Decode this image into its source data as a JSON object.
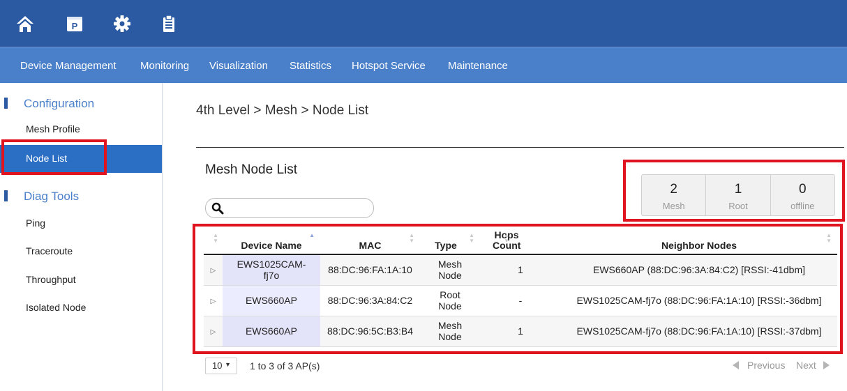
{
  "topbar": {
    "icons": [
      "home-icon",
      "parking-icon",
      "gear-icon",
      "clipboard-icon"
    ]
  },
  "nav": {
    "items": [
      "Device Management",
      "Monitoring",
      "Visualization",
      "Statistics",
      "Hotspot Service",
      "Maintenance"
    ]
  },
  "sidebar": {
    "section1": "Configuration",
    "items1": [
      "Mesh Profile",
      "Node List"
    ],
    "section2": "Diag Tools",
    "items2": [
      "Ping",
      "Traceroute",
      "Throughput",
      "Isolated Node"
    ]
  },
  "breadcrumb": "4th Level > Mesh > Node List",
  "list_title": "Mesh Node List",
  "search": {
    "placeholder": ""
  },
  "stats": [
    {
      "value": "2",
      "label": "Mesh"
    },
    {
      "value": "1",
      "label": "Root"
    },
    {
      "value": "0",
      "label": "offline"
    }
  ],
  "table": {
    "headers": [
      "",
      "Device Name",
      "MAC",
      "Type",
      "Hops Count",
      "Neighbor Nodes"
    ],
    "rows": [
      {
        "expander": "▷",
        "device": "EWS1025CAM-fj7o",
        "mac": "88:DC:96:FA:1A:10",
        "type": "Mesh Node",
        "hops": "1",
        "neighbors": "EWS660AP (88:DC:96:3A:84:C2) [RSSI:-41dbm]"
      },
      {
        "expander": "▷",
        "device": "EWS660AP",
        "mac": "88:DC:96:3A:84:C2",
        "type": "Root Node",
        "hops": "-",
        "neighbors": "EWS1025CAM-fj7o (88:DC:96:FA:1A:10) [RSSI:-36dbm]"
      },
      {
        "expander": "▷",
        "device": "EWS660AP",
        "mac": "88:DC:96:5C:B3:B4",
        "type": "Mesh Node",
        "hops": "1",
        "neighbors": "EWS1025CAM-fj7o (88:DC:96:FA:1A:10) [RSSI:-37dbm]"
      }
    ]
  },
  "footer": {
    "page_size": "10",
    "page_size_caret": "▼",
    "info": "1 to 3 of 3 AP(s)",
    "previous": "Previous",
    "next": "Next"
  },
  "colors": {
    "topbar": "#2b5aa3",
    "navbar": "#4a7fc9",
    "active": "#2b6fc4",
    "highlight": "#e0141e"
  }
}
